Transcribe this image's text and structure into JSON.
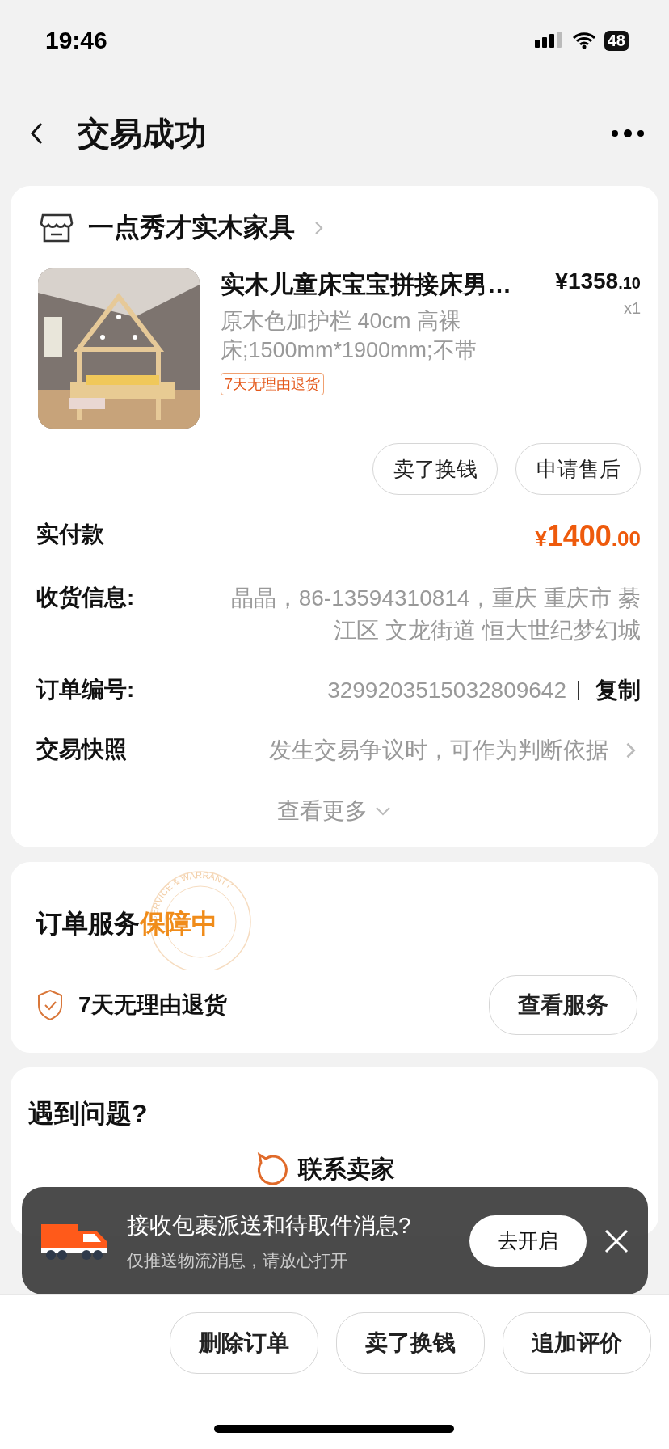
{
  "status_bar": {
    "time": "19:46",
    "battery": "48"
  },
  "header": {
    "title": "交易成功"
  },
  "shop": {
    "name": "一点秀才实木家具"
  },
  "product": {
    "title": "实木儿童床宝宝拼接床男…",
    "spec": "原木色加护栏 40cm 高裸床;1500mm*1900mm;不带",
    "price": {
      "currency": "¥",
      "integer": "1358",
      "decimal": ".10"
    },
    "quantity": "x1",
    "tag": "7天无理由退货",
    "actions": [
      "卖了换钱",
      "申请售后"
    ]
  },
  "paid": {
    "label": "实付款",
    "currency": "¥",
    "integer": "1400",
    "decimal": ".00"
  },
  "info_rows": [
    {
      "kind": "address",
      "label": "收货信息:",
      "value": "晶晶，86-13594310814，重庆 重庆市 綦江区 文龙街道 恒大世纪梦幻城"
    },
    {
      "kind": "order_no",
      "label": "订单编号:",
      "value": "3299203515032809642",
      "action": "复制"
    },
    {
      "kind": "snapshot",
      "label": "交易快照",
      "value": "发生交易争议时，可作为判断依据"
    }
  ],
  "more": "查看更多",
  "service": {
    "title": "订单服务",
    "status": "保障中",
    "stamp_text": "SERVICE & WARRANTY",
    "item": "7天无理由退货",
    "button": "查看服务"
  },
  "help": {
    "title": "遇到问题?",
    "contact": "联系卖家"
  },
  "toast": {
    "title": "接收包裹派送和待取件消息?",
    "subtitle": "仅推送物流消息，请放心打开",
    "button": "去开启"
  },
  "bottom_actions": [
    "删除订单",
    "卖了换钱",
    "追加评价"
  ]
}
